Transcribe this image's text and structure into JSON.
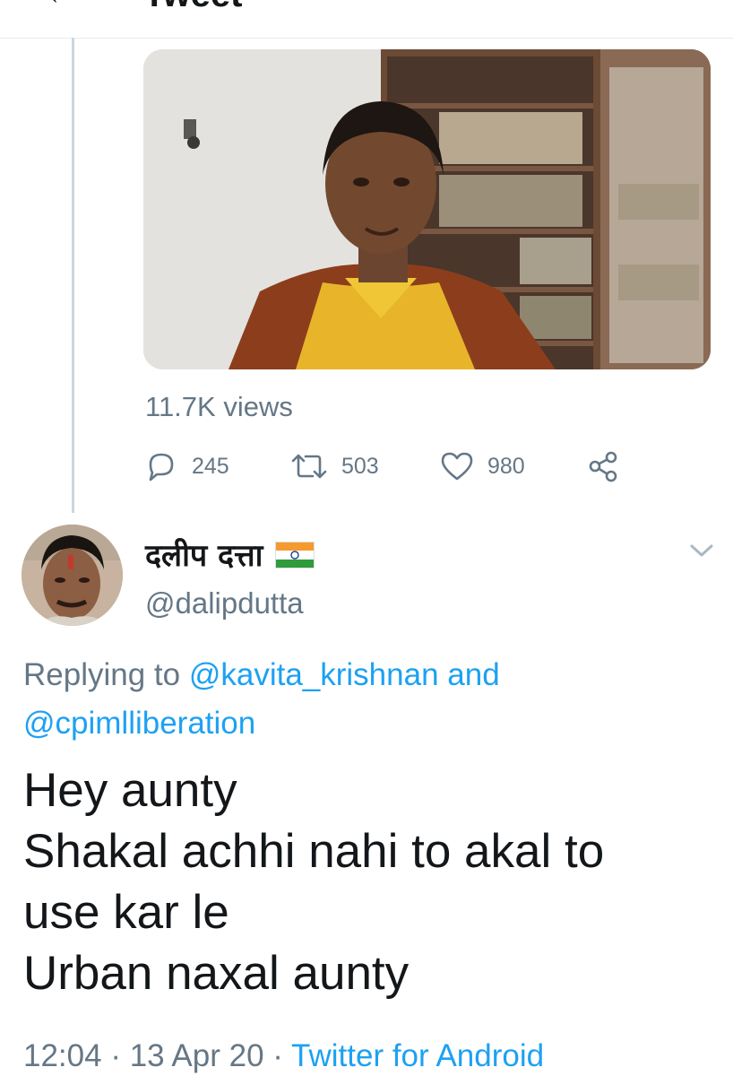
{
  "header": {
    "back_glyph": "←",
    "title": "Tweet"
  },
  "quoted_tweet": {
    "views": "11.7K views",
    "reply_count": "245",
    "retweet_count": "503",
    "like_count": "980",
    "icons": [
      "reply-icon",
      "retweet-icon",
      "like-icon",
      "share-icon"
    ]
  },
  "tweet": {
    "display_name": "दलीप दत्ता",
    "handle": "@dalipdutta",
    "replying_prefix": "Replying to ",
    "replying_user1": "@kavita_krishnan",
    "replying_and": " and",
    "replying_user2": "@cpimlliberation",
    "text_lines": [
      "Hey aunty",
      "Shakal achhi nahi to akal to",
      "use kar le",
      "Urban naxal aunty"
    ],
    "time": "12:04",
    "sep1": " · ",
    "date": "13 Apr 20",
    "sep2": " · ",
    "source": "Twitter for Android"
  },
  "colors": {
    "link": "#1da1f2",
    "secondary": "#657786",
    "text": "#14171a",
    "divider": "#e6ecf0"
  }
}
